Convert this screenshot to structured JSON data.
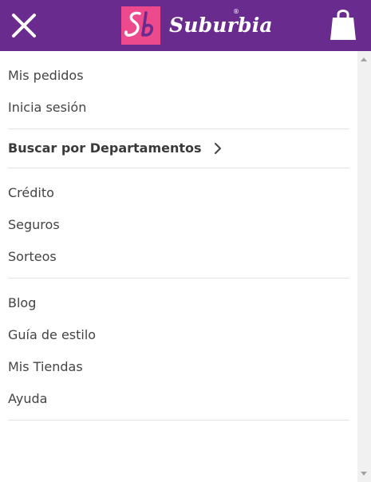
{
  "brand": {
    "name": "Suburbia",
    "registered_mark": "®",
    "primary_color": "#6a2b8e",
    "accent_color": "#ec4a8d"
  },
  "header": {
    "close_icon": "close-icon",
    "cart_icon": "shopping-bag-icon"
  },
  "menu": {
    "group1": [
      {
        "label": "Mis pedidos"
      },
      {
        "label": "Inicia sesión"
      }
    ],
    "group2": [
      {
        "label": "Buscar por Departamentos",
        "icon": "chevron-right-icon"
      }
    ],
    "group3": [
      {
        "label": "Crédito"
      },
      {
        "label": "Seguros"
      },
      {
        "label": "Sorteos"
      }
    ],
    "group4": [
      {
        "label": "Blog"
      },
      {
        "label": "Guía de estilo"
      },
      {
        "label": "Mis Tiendas"
      },
      {
        "label": "Ayuda"
      }
    ]
  }
}
